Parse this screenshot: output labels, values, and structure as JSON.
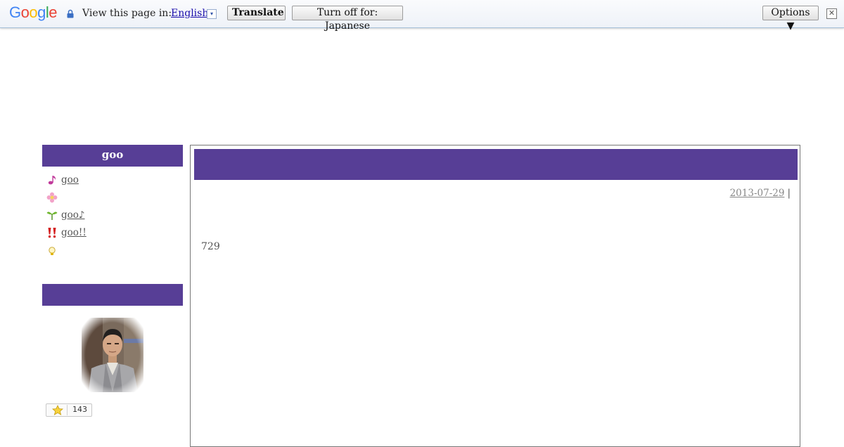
{
  "translate_bar": {
    "logo_letters": [
      "G",
      "o",
      "o",
      "g",
      "l",
      "e"
    ],
    "view_label": "View this page in:",
    "language": "English",
    "language_dropdown_glyph": "▾",
    "translate_label": "Translate",
    "turn_off_label": "Turn off for: Japanese",
    "options_label": "Options ▼",
    "close_glyph": "✕",
    "lock_icon": "lock-icon"
  },
  "sidebar": {
    "header_1": "goo",
    "header_2": "",
    "menu": [
      {
        "icon": "music-note-icon",
        "label": "goo"
      },
      {
        "icon": "flower-icon",
        "label": ""
      },
      {
        "icon": "sprout-icon",
        "label": "goo♪  "
      },
      {
        "icon": "double-exclamation-icon",
        "label": "goo!! "
      },
      {
        "icon": "lightbulb-icon",
        "label": ""
      }
    ],
    "star_count": "143"
  },
  "post": {
    "date": "2013-07-29",
    "separator": "|",
    "category": "  ",
    "body": "729"
  },
  "colors": {
    "accent": "#573e96",
    "link": "#1a0dab"
  }
}
